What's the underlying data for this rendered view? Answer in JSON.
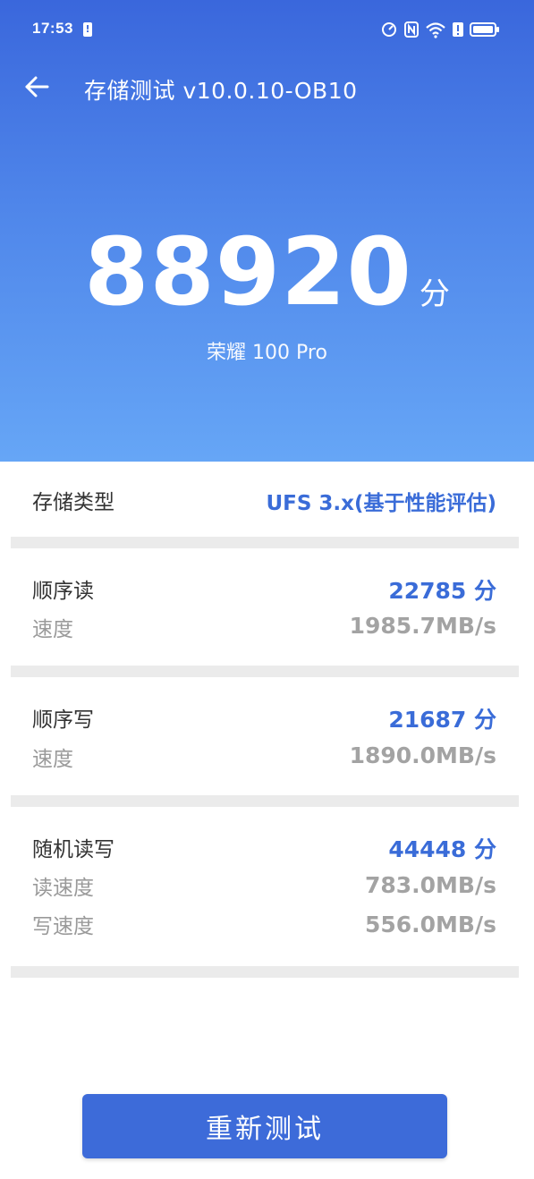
{
  "status_bar": {
    "time": "17:53",
    "alert_glyph": "!",
    "icons": [
      "speed-icon",
      "nfc-icon",
      "wifi-icon",
      "alert-icon",
      "battery-icon"
    ]
  },
  "toolbar": {
    "back_icon": "arrow-left-icon",
    "title": "存储测试 v10.0.10-OB10"
  },
  "hero": {
    "score": "88920",
    "score_unit": "分",
    "device": "荣耀 100 Pro"
  },
  "storage_type": {
    "label": "存储类型",
    "value": "UFS 3.x(基于性能评估)"
  },
  "sequential_read": {
    "label": "顺序读",
    "score": "22785 分",
    "speed_label": "速度",
    "speed": "1985.7MB/s"
  },
  "sequential_write": {
    "label": "顺序写",
    "score": "21687 分",
    "speed_label": "速度",
    "speed": "1890.0MB/s"
  },
  "random_rw": {
    "label": "随机读写",
    "score": "44448 分",
    "read_speed_label": "读速度",
    "read_speed": "783.0MB/s",
    "write_speed_label": "写速度",
    "write_speed": "556.0MB/s"
  },
  "actions": {
    "retest_label": "重新测试"
  },
  "colors": {
    "accent": "#3a6cd8",
    "hero_top": "#3a67dc",
    "hero_bottom": "#66a6f6",
    "divider": "#ebebeb",
    "muted_text": "#a3a3a3"
  }
}
